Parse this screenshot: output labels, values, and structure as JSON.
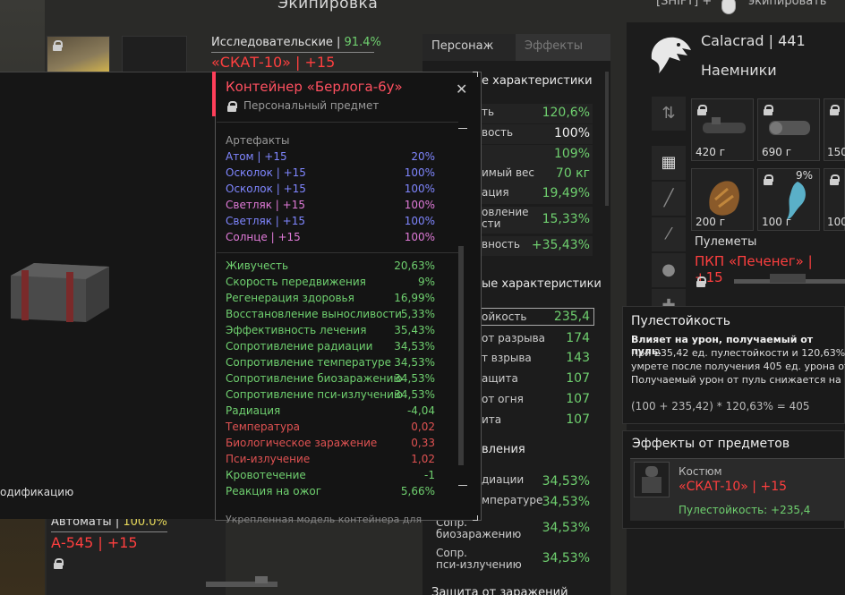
{
  "header": {
    "title": "Экипировка",
    "shift_hint": "[SHIFT] +",
    "equip_label": "экипировать"
  },
  "suit": {
    "stat_label": "Исследовательские | ",
    "stat_value": "91.4%",
    "name": "«СКАТ-10» | +15"
  },
  "rifle": {
    "stat_label": "Автоматы | ",
    "stat_value": "100.0%",
    "name": "А-545 | +15"
  },
  "container": {
    "title": "Контейнер «Берлога-6у»",
    "personal": "Персональный предмет",
    "artifacts_title": "Артефакты",
    "artifacts": [
      {
        "name": "Атом | +15",
        "value": "20%",
        "color": "blue"
      },
      {
        "name": "Осколок | +15",
        "value": "100%",
        "color": "blue"
      },
      {
        "name": "Осколок | +15",
        "value": "100%",
        "color": "blue"
      },
      {
        "name": "Светляк | +15",
        "value": "100%",
        "color": "pink"
      },
      {
        "name": "Светляк | +15",
        "value": "100%",
        "color": "blue"
      },
      {
        "name": "Солнце | +15",
        "value": "100%",
        "color": "pink"
      }
    ],
    "stats": [
      {
        "name": "Живучесть",
        "value": "20,63%",
        "color": "green"
      },
      {
        "name": "Скорость передвижения",
        "value": "9%",
        "color": "green"
      },
      {
        "name": "Регенерация здоровья",
        "value": "16,99%",
        "color": "green"
      },
      {
        "name": "Восстановление выносливости",
        "value": "5,33%",
        "color": "green"
      },
      {
        "name": "Эффективность лечения",
        "value": "35,43%",
        "color": "green"
      },
      {
        "name": "Сопротивление радиации",
        "value": "34,53%",
        "color": "green"
      },
      {
        "name": "Сопротивление температуре",
        "value": "34,53%",
        "color": "green"
      },
      {
        "name": "Сопротивление биозаражению",
        "value": "34,53%",
        "color": "green"
      },
      {
        "name": "Сопротивление пси-излучению",
        "value": "34,53%",
        "color": "green"
      },
      {
        "name": "Радиация",
        "value": "-4,04",
        "color": "green"
      },
      {
        "name": "Температура",
        "value": "0,02",
        "color": "red"
      },
      {
        "name": "Биологическое заражение",
        "value": "0,33",
        "color": "red"
      },
      {
        "name": "Пси-излучение",
        "value": "1,02",
        "color": "red"
      },
      {
        "name": "Кровотечение",
        "value": "-1",
        "color": "green"
      },
      {
        "name": "Реакция на ожог",
        "value": "5,66%",
        "color": "green"
      }
    ],
    "footer": "Укрепленная модель контейнера для",
    "mod_label": "одификацию"
  },
  "tabs": {
    "person": "Персонаж",
    "effects": "Эффекты"
  },
  "center": {
    "sec1": "е характеристики",
    "rows1": [
      {
        "label": "ть",
        "value": "120,6%",
        "color": "green"
      },
      {
        "label": "вость",
        "value": "100%",
        "color": "white"
      },
      {
        "label": "",
        "value": "109%",
        "color": "green"
      },
      {
        "label": "имый вес",
        "value": "70 кг",
        "color": "green"
      },
      {
        "label": "ация",
        "value": "19,49%",
        "color": "green"
      },
      {
        "label": "овление\nсти",
        "value": "15,33%",
        "color": "green"
      },
      {
        "label": "вность",
        "value": "+35,43%",
        "color": "green"
      }
    ],
    "sec2": "ые характеристики",
    "rows2": [
      {
        "label": "ойкость",
        "value": "235,4"
      },
      {
        "label": "от разрыва",
        "value": "174"
      },
      {
        "label": "т взрыва",
        "value": "143"
      },
      {
        "label": "ащита",
        "value": "107"
      },
      {
        "label": "от огня",
        "value": "107"
      },
      {
        "label": "ита",
        "value": "107"
      }
    ],
    "sec3": "вления",
    "rows3": [
      {
        "label": "диации",
        "value": "34,53%"
      },
      {
        "label": "мпературе",
        "value": "34,53%"
      },
      {
        "label": "Сопр.\nбиозаражению",
        "value": "34,53%"
      },
      {
        "label": "Сопр.\nпси-излучению",
        "value": "34,53%"
      }
    ],
    "sec4": "Защита от заражений"
  },
  "character": {
    "name": "Calacrad | 441",
    "faction": "Наемники"
  },
  "inventory": {
    "weights": [
      "420 г",
      "690 г",
      "150",
      "200 г",
      "100 г",
      "100"
    ],
    "cell3_pct": "9%",
    "mg_label": "Пулеметы",
    "mg_name": "ПКП «Печенег» | +15"
  },
  "tooltip": {
    "title": "Пулестойкость",
    "subtitle": "Влияет на урон, получаемый от пуль.",
    "lines": [
      "При 235,42 ед. пулестойкости и 120,63%",
      "умрете после получения 405 ед. урона от п",
      "Получаемый урон от пуль снижается на 70"
    ],
    "formula": "(100 + 235,42) * 120,63% = 405"
  },
  "item_effects": {
    "title": "Эффекты от предметов",
    "kind": "Костюм",
    "name": "«СКАТ-10» | +15",
    "effect": "Пулестойкость: +235,4"
  },
  "colors": {
    "accent_red": "#ff3f3f",
    "green": "#6fd06f",
    "blue": "#7f86ff",
    "pink": "#e07ad8"
  }
}
